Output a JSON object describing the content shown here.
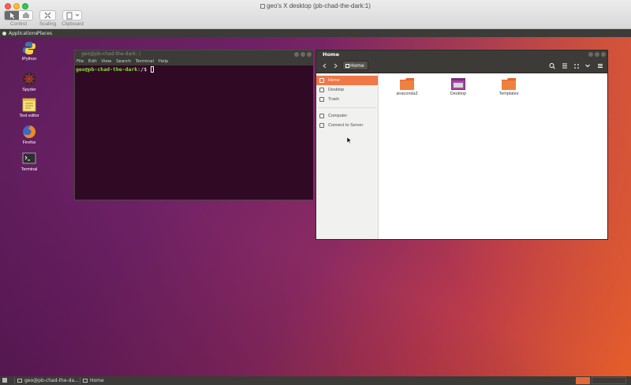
{
  "window": {
    "title": "geo's X desktop (pb-chad-the-dark:1)"
  },
  "viewer_toolbar": {
    "control": "Control",
    "scaling": "Scaling",
    "clipboard": "Clipboard"
  },
  "top_panel": {
    "applications": "Applications",
    "places": "Places"
  },
  "desktop_icons": [
    {
      "label": "IPython",
      "icon": "python-icon"
    },
    {
      "label": "Spyder",
      "icon": "spyder-icon"
    },
    {
      "label": "Text editor",
      "icon": "text-editor-icon"
    },
    {
      "label": "Firefox",
      "icon": "firefox-icon"
    },
    {
      "label": "Terminal",
      "icon": "terminal-icon"
    }
  ],
  "terminal": {
    "title": "geo@pb-chad-the-dark: /",
    "menu": [
      "File",
      "Edit",
      "View",
      "Search",
      "Terminal",
      "Help"
    ],
    "prompt_user": "geo@pb-chad-the-dark",
    "prompt_path": ":/$ "
  },
  "files": {
    "title": "Home",
    "path_label": "Home",
    "sidebar": [
      {
        "label": "Home",
        "active": true
      },
      {
        "label": "Desktop"
      },
      {
        "label": "Trash"
      },
      {
        "label": "Computer"
      },
      {
        "label": "Connect to Server"
      }
    ],
    "items": [
      {
        "label": "anaconda3"
      },
      {
        "label": "Desktop"
      },
      {
        "label": "Templates"
      }
    ]
  },
  "taskbar": [
    {
      "label": "geo@pb-chad-the-da..."
    },
    {
      "label": "Home"
    }
  ],
  "colors": {
    "accent": "#f07746",
    "terminal_bg": "#300a24",
    "prompt_green": "#8ae234",
    "panel": "#3c3b37"
  }
}
